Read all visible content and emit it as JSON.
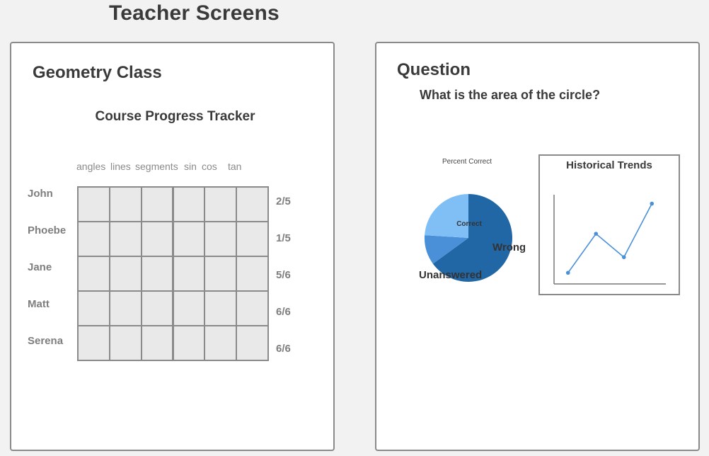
{
  "page": {
    "title": "Teacher Screens"
  },
  "left_panel": {
    "class_title": "Geometry Class",
    "tracker_title": "Course Progress Tracker",
    "columns": [
      "angles",
      "lines",
      "segments",
      "sin",
      "cos",
      "tan"
    ],
    "students": [
      {
        "name": "John",
        "score": "2/5"
      },
      {
        "name": "Phoebe",
        "score": "1/5"
      },
      {
        "name": "Jane",
        "score": "5/6"
      },
      {
        "name": "Matt",
        "score": "6/6"
      },
      {
        "name": "Serena",
        "score": "6/6"
      }
    ]
  },
  "right_panel": {
    "heading": "Question",
    "question": "What is the area of the circle?",
    "chart_data": [
      {
        "type": "pie",
        "title": "Percent Correct",
        "slices": [
          {
            "label": "Correct",
            "value": 65,
            "color": "#2166a5"
          },
          {
            "label": "Wrong",
            "value": 11,
            "color": "#4a90d9"
          },
          {
            "label": "Unanswered",
            "value": 24,
            "color": "#7fbff5"
          }
        ]
      },
      {
        "type": "line",
        "title": "Historical Trends",
        "x": [
          1,
          2,
          3,
          4
        ],
        "series": [
          {
            "values": [
              1,
              4.5,
              2.4,
              7.2
            ]
          }
        ],
        "ylim": [
          0,
          8
        ],
        "xlabel": "",
        "ylabel": "",
        "color": "#4a90d9",
        "grid": false
      }
    ]
  }
}
